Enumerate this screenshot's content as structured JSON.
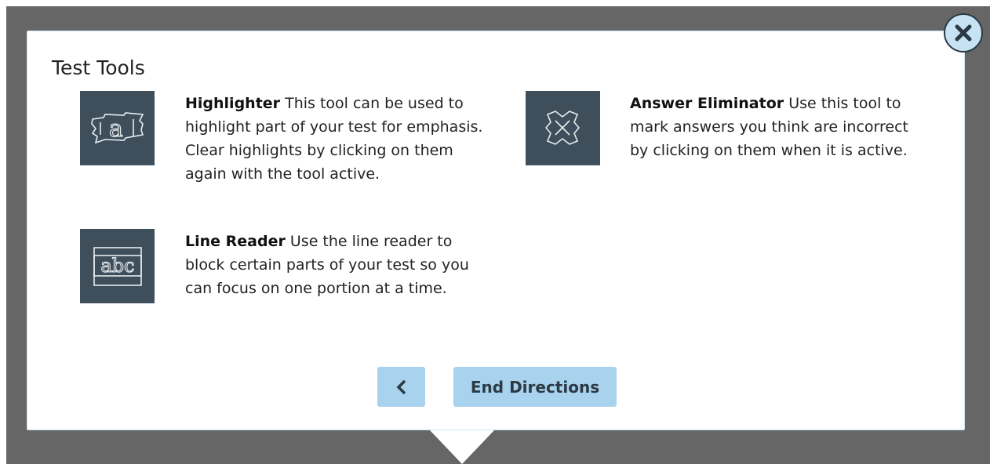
{
  "dialog": {
    "title": "Test Tools",
    "tools": [
      {
        "name": "Highlighter",
        "description": "This tool can be used to highlight part of your test for emphasis. Clear highlights by clicking on them again with the tool active.",
        "icon": "highlighter-icon"
      },
      {
        "name": "Answer Eliminator",
        "description": "Use this tool to mark answers you think are incorrect by clicking on them when it is active.",
        "icon": "answer-eliminator-icon"
      },
      {
        "name": "Line Reader",
        "description": "Use the line reader to block certain parts of your test so you can focus on one portion at a time.",
        "icon": "line-reader-icon"
      }
    ]
  },
  "buttons": {
    "back_icon": "chevron-left-icon",
    "end_label": "End Directions",
    "close_icon": "close-icon"
  },
  "colors": {
    "overlay": "#666666",
    "icon_bg": "#3e4f5b",
    "button_bg": "#a8d2ee",
    "close_bg": "#c7e2f2"
  }
}
